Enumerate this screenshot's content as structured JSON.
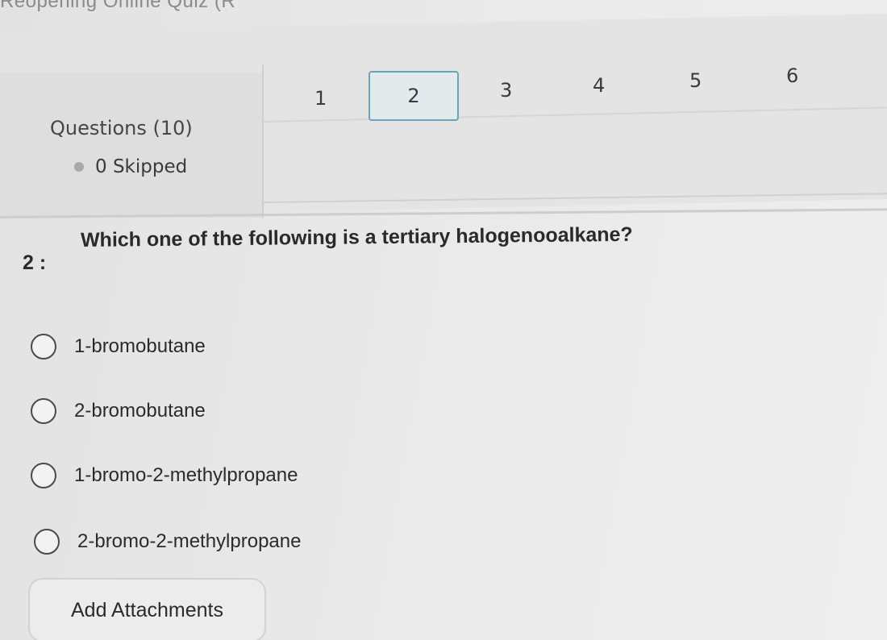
{
  "header": {
    "title": "Reopening Online Quiz (R"
  },
  "sidebar": {
    "questions_label": "Questions (10)",
    "skipped_label": "0 Skipped"
  },
  "nav": {
    "questions": [
      "1",
      "2",
      "3",
      "4",
      "5",
      "6"
    ],
    "active_index": 1
  },
  "question": {
    "number": "2 :",
    "text": "Which one of the following is a tertiary halogenooalkane?",
    "options": [
      "1-bromobutane",
      "2-bromobutane",
      "1-bromo-2-methylpropane",
      "2-bromo-2-methylpropane"
    ]
  },
  "actions": {
    "attachments_label": "Add Attachments"
  },
  "colors": {
    "active_border": "#6aa4b8",
    "background": "#e6e6e6"
  }
}
